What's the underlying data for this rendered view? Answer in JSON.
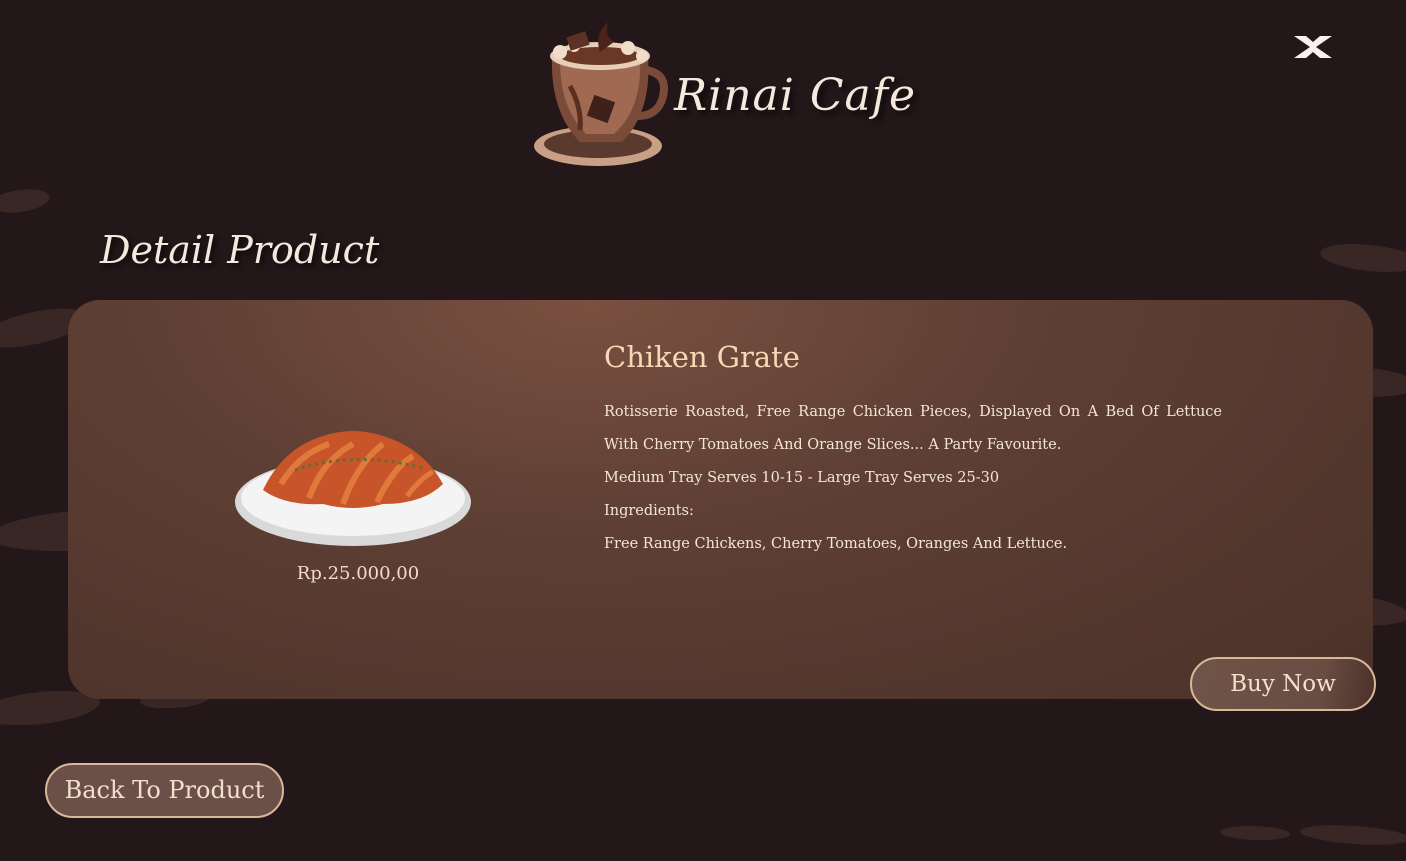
{
  "header": {
    "brand_name": "Rinai Cafe",
    "logo_icon": "coffee-cup-logo",
    "close_icon": "close-icon"
  },
  "page": {
    "title": "Detail Product"
  },
  "product": {
    "name": "Chiken Grate",
    "price": "Rp.25.000,00",
    "image_icon": "croissant-plate-image",
    "description": [
      "Rotisserie Roasted, Free Range Chicken Pieces, Displayed On A Bed Of Lettuce With Cherry Tomatoes And Orange Slices... A Party Favourite.",
      "Medium Tray Serves 10-15 - Large Tray Serves 25-30",
      "Ingredients:",
      "Free Range Chickens, Cherry Tomatoes, Oranges And Lettuce."
    ]
  },
  "actions": {
    "buy_label": "Buy Now",
    "back_label": "Back To Product"
  },
  "colors": {
    "background": "#231719",
    "card": "#5e3f34",
    "accent_border": "#d9b79a",
    "title_text": "#f6d8b6"
  }
}
